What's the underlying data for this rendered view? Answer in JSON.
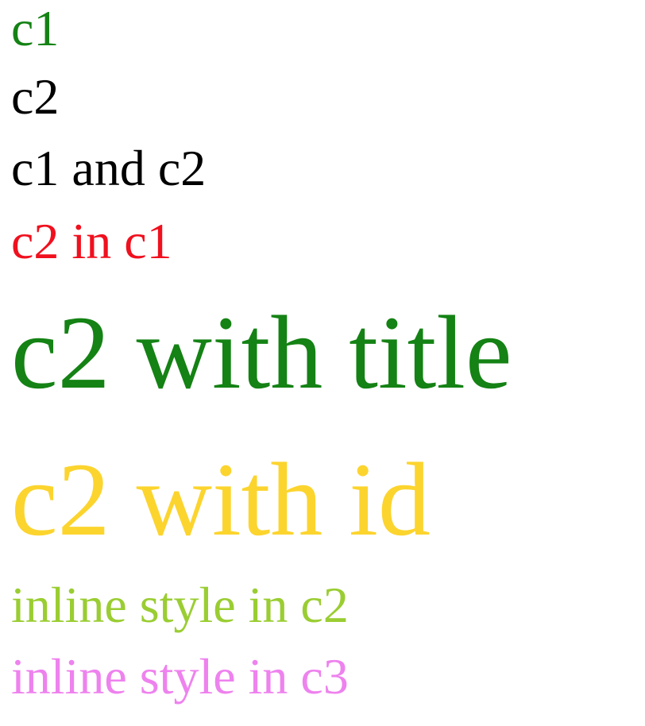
{
  "lines": [
    {
      "text": "c1",
      "color": "#148214"
    },
    {
      "text": "c2",
      "color": "#000000"
    },
    {
      "text": "c1 and c2",
      "color": "#000000"
    },
    {
      "text": "c2 in c1",
      "color": "#f0101e"
    },
    {
      "text": "c2 with title",
      "color": "#148214"
    },
    {
      "text": "c2 with id",
      "color": "#fcd42e"
    },
    {
      "text": "inline style in c2",
      "color": "#9acd32"
    },
    {
      "text": "inline style in c3",
      "color": "#ee82ee"
    }
  ]
}
